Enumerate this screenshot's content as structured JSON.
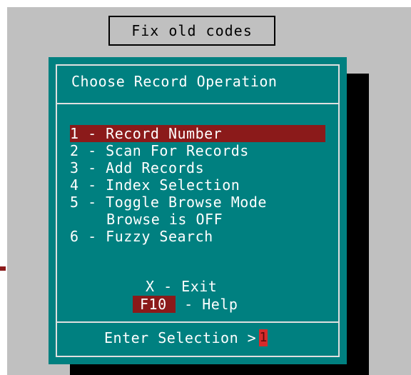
{
  "app": {
    "title": "Fix old codes"
  },
  "dialog": {
    "title": "Choose Record Operation",
    "menu": [
      {
        "label": "1 - Record Number",
        "selected": true
      },
      {
        "label": "2 - Scan For Records"
      },
      {
        "label": "3 - Add Records"
      },
      {
        "label": "4 - Index Selection"
      },
      {
        "label": "5 - Toggle Browse Mode"
      },
      {
        "label": "  Browse is OFF"
      },
      {
        "label": "6 - Fuzzy Search"
      }
    ],
    "exit_label": "X - Exit",
    "help_key": "F10",
    "help_label": " - Help",
    "prompt": "Enter Selection >",
    "input_value": "1"
  },
  "colors": {
    "desktop": "#c0c0c0",
    "dialog_bg": "#008080",
    "highlight": "#8b1a1a",
    "cursor": "#d62b2b",
    "text": "#ffffff",
    "shadow": "#000000"
  }
}
